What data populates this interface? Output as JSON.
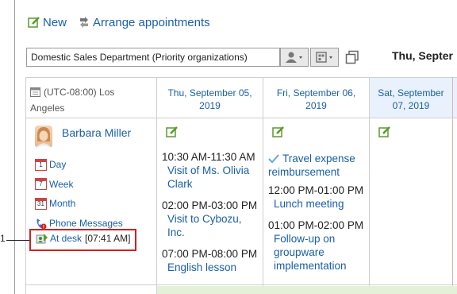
{
  "toolbar": {
    "new_label": "New",
    "arrange_label": "Arrange appointments"
  },
  "filter": {
    "selected": "Domestic Sales Department (Priority organizations)"
  },
  "week_title": "Thu, Septer",
  "timezone": {
    "line1": "(UTC-08:00) Los",
    "line2": "Angeles"
  },
  "days": [
    {
      "line1": "Thu, September 05,",
      "line2": "2019"
    },
    {
      "line1": "Fri, September 06,",
      "line2": "2019"
    },
    {
      "line1": "Sat, September",
      "line2": "07, 2019"
    }
  ],
  "user": {
    "name": "Barbara Miller",
    "links": {
      "day": "Day",
      "week": "Week",
      "month": "Month",
      "phone": "Phone Messages"
    },
    "status_label": "At desk",
    "status_time": "[07:41 AM]"
  },
  "callout_number": "1",
  "thu_events": [
    {
      "time": "10:30 AM-11:30 AM",
      "title": "Visit of Ms. Olivia Clark",
      "title1": "Visit of Ms. Olivia",
      "title2": "Clark"
    },
    {
      "time": "02:00 PM-03:00 PM",
      "title": "Visit to Cybozu, Inc.",
      "title1": "Visit to Cybozu,",
      "title2": "Inc."
    },
    {
      "time": "07:00 PM-08:00 PM",
      "title": "English lesson"
    }
  ],
  "fri_todo": {
    "line1": "Travel expense",
    "line2": "reimbursement"
  },
  "fri_events": [
    {
      "time": "12:00 PM-01:00 PM",
      "title": "Lunch meeting"
    },
    {
      "time": "01:00 PM-02:00 PM",
      "title1": "Follow-up on",
      "title2": "groupware",
      "title3": "implementation"
    }
  ],
  "icons": {
    "accent": "#1a5fa8",
    "edit_green": "#5a9a2a",
    "alert_red": "#d02020"
  }
}
